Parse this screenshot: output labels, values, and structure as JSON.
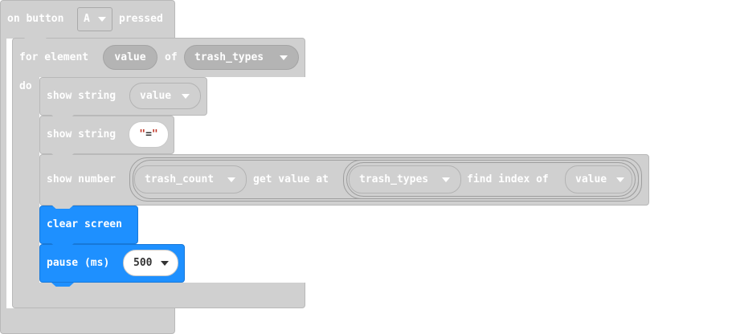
{
  "event_block": {
    "label_on": "on button",
    "button_value": "A",
    "label_pressed": "pressed"
  },
  "for_block": {
    "label_for": "for element",
    "var_name": "value",
    "label_of": "of",
    "array_name": "trash_types",
    "label_do": "do"
  },
  "show_string_1": {
    "label": "show string",
    "value": "value"
  },
  "show_string_2": {
    "label": "show string",
    "quote_open": "\"",
    "value": "=",
    "quote_close": "\""
  },
  "show_number": {
    "label": "show number",
    "array_name": "trash_count",
    "label_get": "get value at",
    "inner_array": "trash_types",
    "label_find": "find index of",
    "inner_value": "value"
  },
  "clear_screen": {
    "label": "clear screen"
  },
  "pause": {
    "label": "pause (ms)",
    "value": "500"
  },
  "colors": {
    "loops_gray": "#d0d0d0",
    "basic_blue": "#1e90ff"
  },
  "icons": [
    "chevron-down-icon"
  ]
}
